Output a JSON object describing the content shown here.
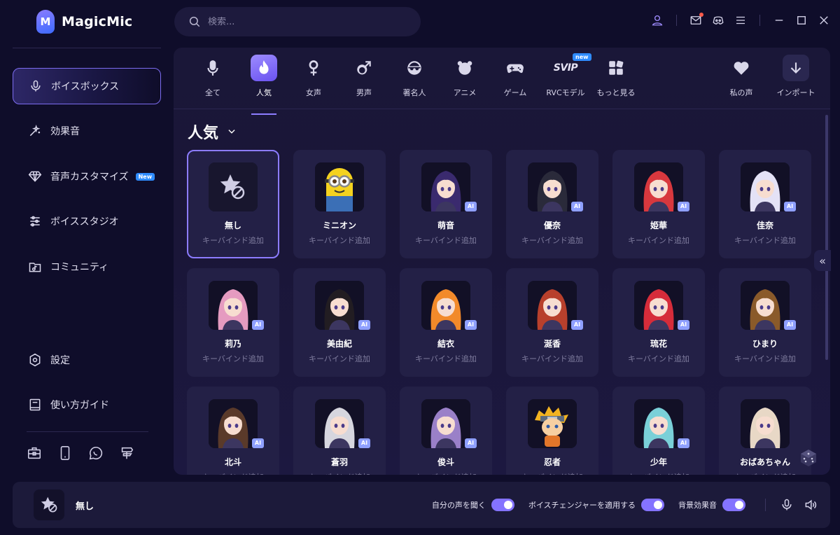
{
  "app": {
    "name": "MagicMic"
  },
  "search": {
    "placeholder": "検索..."
  },
  "sidebar": {
    "items": [
      {
        "label": "ボイスボックス",
        "icon": "mic-icon",
        "active": true
      },
      {
        "label": "効果音",
        "icon": "magic-wand-icon"
      },
      {
        "label": "音声カスタマイズ",
        "icon": "diamond-icon",
        "badge": "New"
      },
      {
        "label": "ボイススタジオ",
        "icon": "sliders-icon"
      },
      {
        "label": "コミュニティ",
        "icon": "music-folder-icon"
      }
    ],
    "bottom_items": [
      {
        "label": "設定",
        "icon": "gear-icon"
      },
      {
        "label": "使い方ガイド",
        "icon": "book-icon"
      }
    ],
    "tools": [
      "toolbox-icon",
      "phone-icon",
      "chat-icon",
      "signpost-icon"
    ]
  },
  "categories": [
    {
      "label": "全て",
      "icon": "mic-icon"
    },
    {
      "label": "人気",
      "icon": "flame-icon",
      "active": true
    },
    {
      "label": "女声",
      "icon": "female-icon"
    },
    {
      "label": "男声",
      "icon": "male-icon"
    },
    {
      "label": "著名人",
      "icon": "celebrity-glasses-icon"
    },
    {
      "label": "アニメ",
      "icon": "bear-icon"
    },
    {
      "label": "ゲーム",
      "icon": "gamepad-icon"
    },
    {
      "label": "RVCモデル",
      "icon": "svip-icon",
      "tag": "new",
      "icon_text": "SVIP"
    },
    {
      "label": "もっと見る",
      "icon": "grid-icon"
    },
    {
      "label": "私の声",
      "icon": "heart-icon"
    },
    {
      "label": "インポート",
      "icon": "import-icon"
    }
  ],
  "section": {
    "title": "人気"
  },
  "voices": [
    {
      "name": "無し",
      "sub": "キーバインド追加",
      "selected": true,
      "ai": false,
      "avatar": "no-voice"
    },
    {
      "name": "ミニオン",
      "sub": "キーバインド追加",
      "ai": false,
      "avatar": "minion",
      "color": "#f4d21f"
    },
    {
      "name": "萌音",
      "sub": "キーバインド追加",
      "ai": true,
      "avatar": "anime",
      "color": "#3a2a6e"
    },
    {
      "name": "優奈",
      "sub": "キーバインド追加",
      "ai": true,
      "avatar": "anime",
      "color": "#2a2a3a"
    },
    {
      "name": "姫華",
      "sub": "キーバインド追加",
      "ai": true,
      "avatar": "anime",
      "color": "#d8383e"
    },
    {
      "name": "佳奈",
      "sub": "キーバインド追加",
      "ai": true,
      "avatar": "anime",
      "color": "#e4e2f6"
    },
    {
      "name": "莉乃",
      "sub": "キーバインド追加",
      "ai": true,
      "avatar": "anime",
      "color": "#e59bc0"
    },
    {
      "name": "美由紀",
      "sub": "キーバインド追加",
      "ai": true,
      "avatar": "anime",
      "color": "#221d22"
    },
    {
      "name": "結衣",
      "sub": "キーバインド追加",
      "ai": true,
      "avatar": "anime",
      "color": "#f28a2a"
    },
    {
      "name": "涎香",
      "sub": "キーバインド追加",
      "ai": true,
      "avatar": "anime",
      "color": "#b8402c"
    },
    {
      "name": "琉花",
      "sub": "キーバインド追加",
      "ai": true,
      "avatar": "anime",
      "color": "#d62c3a"
    },
    {
      "name": "ひまり",
      "sub": "キーバインド追加",
      "ai": true,
      "avatar": "anime",
      "color": "#8a5a2a"
    },
    {
      "name": "北斗",
      "sub": "キーバインド追加",
      "ai": true,
      "avatar": "anime",
      "color": "#5a3a2a"
    },
    {
      "name": "蒼羽",
      "sub": "キーバインド追加",
      "ai": true,
      "avatar": "anime",
      "color": "#d6d6de"
    },
    {
      "name": "俊斗",
      "sub": "キーバインド追加",
      "ai": true,
      "avatar": "anime",
      "color": "#9a80c8"
    },
    {
      "name": "忍者",
      "sub": "キーバインド追加",
      "ai": false,
      "avatar": "ninja",
      "color": "#f2b321"
    },
    {
      "name": "少年",
      "sub": "キーバインド追加",
      "ai": true,
      "avatar": "anime",
      "color": "#7ad0d8"
    },
    {
      "name": "おばあちゃん",
      "sub": "キーバインド追加",
      "ai": false,
      "avatar": "anime",
      "color": "#e8d8c6"
    }
  ],
  "bottom_bar": {
    "current_voice": "無し",
    "toggles": [
      {
        "label": "自分の声を聞く",
        "on": true
      },
      {
        "label": "ボイスチェンジャーを適用する",
        "on": true
      },
      {
        "label": "背景効果音",
        "on": true
      }
    ]
  },
  "colors": {
    "accent": "#8473ff",
    "bg": "#0f0d2a",
    "panel": "#1a1738",
    "card": "#232046",
    "new_badge": "#2f8cff"
  }
}
